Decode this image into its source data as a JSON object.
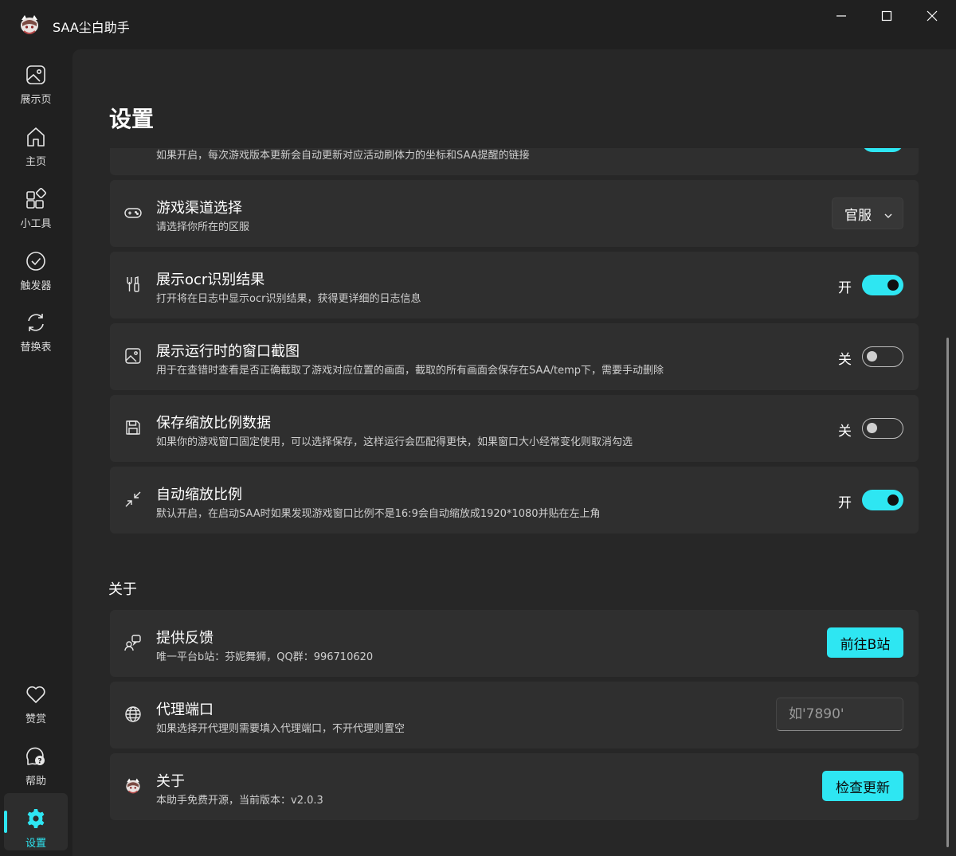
{
  "app": {
    "title": "SAA尘白助手"
  },
  "sidebar": {
    "items": [
      {
        "label": "展示页",
        "icon": "image-icon"
      },
      {
        "label": "主页",
        "icon": "home-icon"
      },
      {
        "label": "小工具",
        "icon": "apps-icon"
      },
      {
        "label": "触发器",
        "icon": "check-circle-icon"
      },
      {
        "label": "替换表",
        "icon": "refresh-icon"
      }
    ],
    "bottom_items": [
      {
        "label": "赞赏",
        "icon": "heart-icon"
      },
      {
        "label": "帮助",
        "icon": "help-icon"
      },
      {
        "label": "设置",
        "icon": "gear-icon",
        "active": true
      }
    ]
  },
  "page": {
    "title": "设置"
  },
  "settings": {
    "partial": {
      "desc": "如果开启，每次游戏版本更新会自动更新对应活动刷体力的坐标和SAA提醒的链接"
    },
    "channel": {
      "title": "游戏渠道选择",
      "desc": "请选择你所在的区服",
      "value": "官服"
    },
    "ocr": {
      "title": "展示ocr识别结果",
      "desc": "打开将在日志中显示ocr识别结果，获得更详细的日志信息",
      "state": "开",
      "on": true
    },
    "screenshot": {
      "title": "展示运行时的窗口截图",
      "desc": "用于在查错时查看是否正确截取了游戏对应位置的画面，截取的所有画面会保存在SAA/temp下，需要手动删除",
      "state": "关",
      "on": false
    },
    "save_ratio": {
      "title": "保存缩放比例数据",
      "desc": "如果你的游戏窗口固定使用，可以选择保存，这样运行会匹配得更快，如果窗口大小经常变化则取消勾选",
      "state": "关",
      "on": false
    },
    "auto_scale": {
      "title": "自动缩放比例",
      "desc": "默认开启，在启动SAA时如果发现游戏窗口比例不是16:9会自动缩放成1920*1080并贴在左上角",
      "state": "开",
      "on": true
    }
  },
  "about_section": {
    "label": "关于",
    "feedback": {
      "title": "提供反馈",
      "desc": "唯一平台b站：芬妮舞狮，QQ群：996710620",
      "button": "前往B站"
    },
    "proxy": {
      "title": "代理端口",
      "desc": "如果选择开代理则需要填入代理端口，不开代理则置空",
      "placeholder": "如'7890'"
    },
    "about": {
      "title": "关于",
      "desc": "本助手免费开源，当前版本：v2.0.3",
      "button": "检查更新"
    }
  },
  "colors": {
    "accent": "#2ee6f2",
    "background": "#202020",
    "card": "#2f2f2f"
  }
}
